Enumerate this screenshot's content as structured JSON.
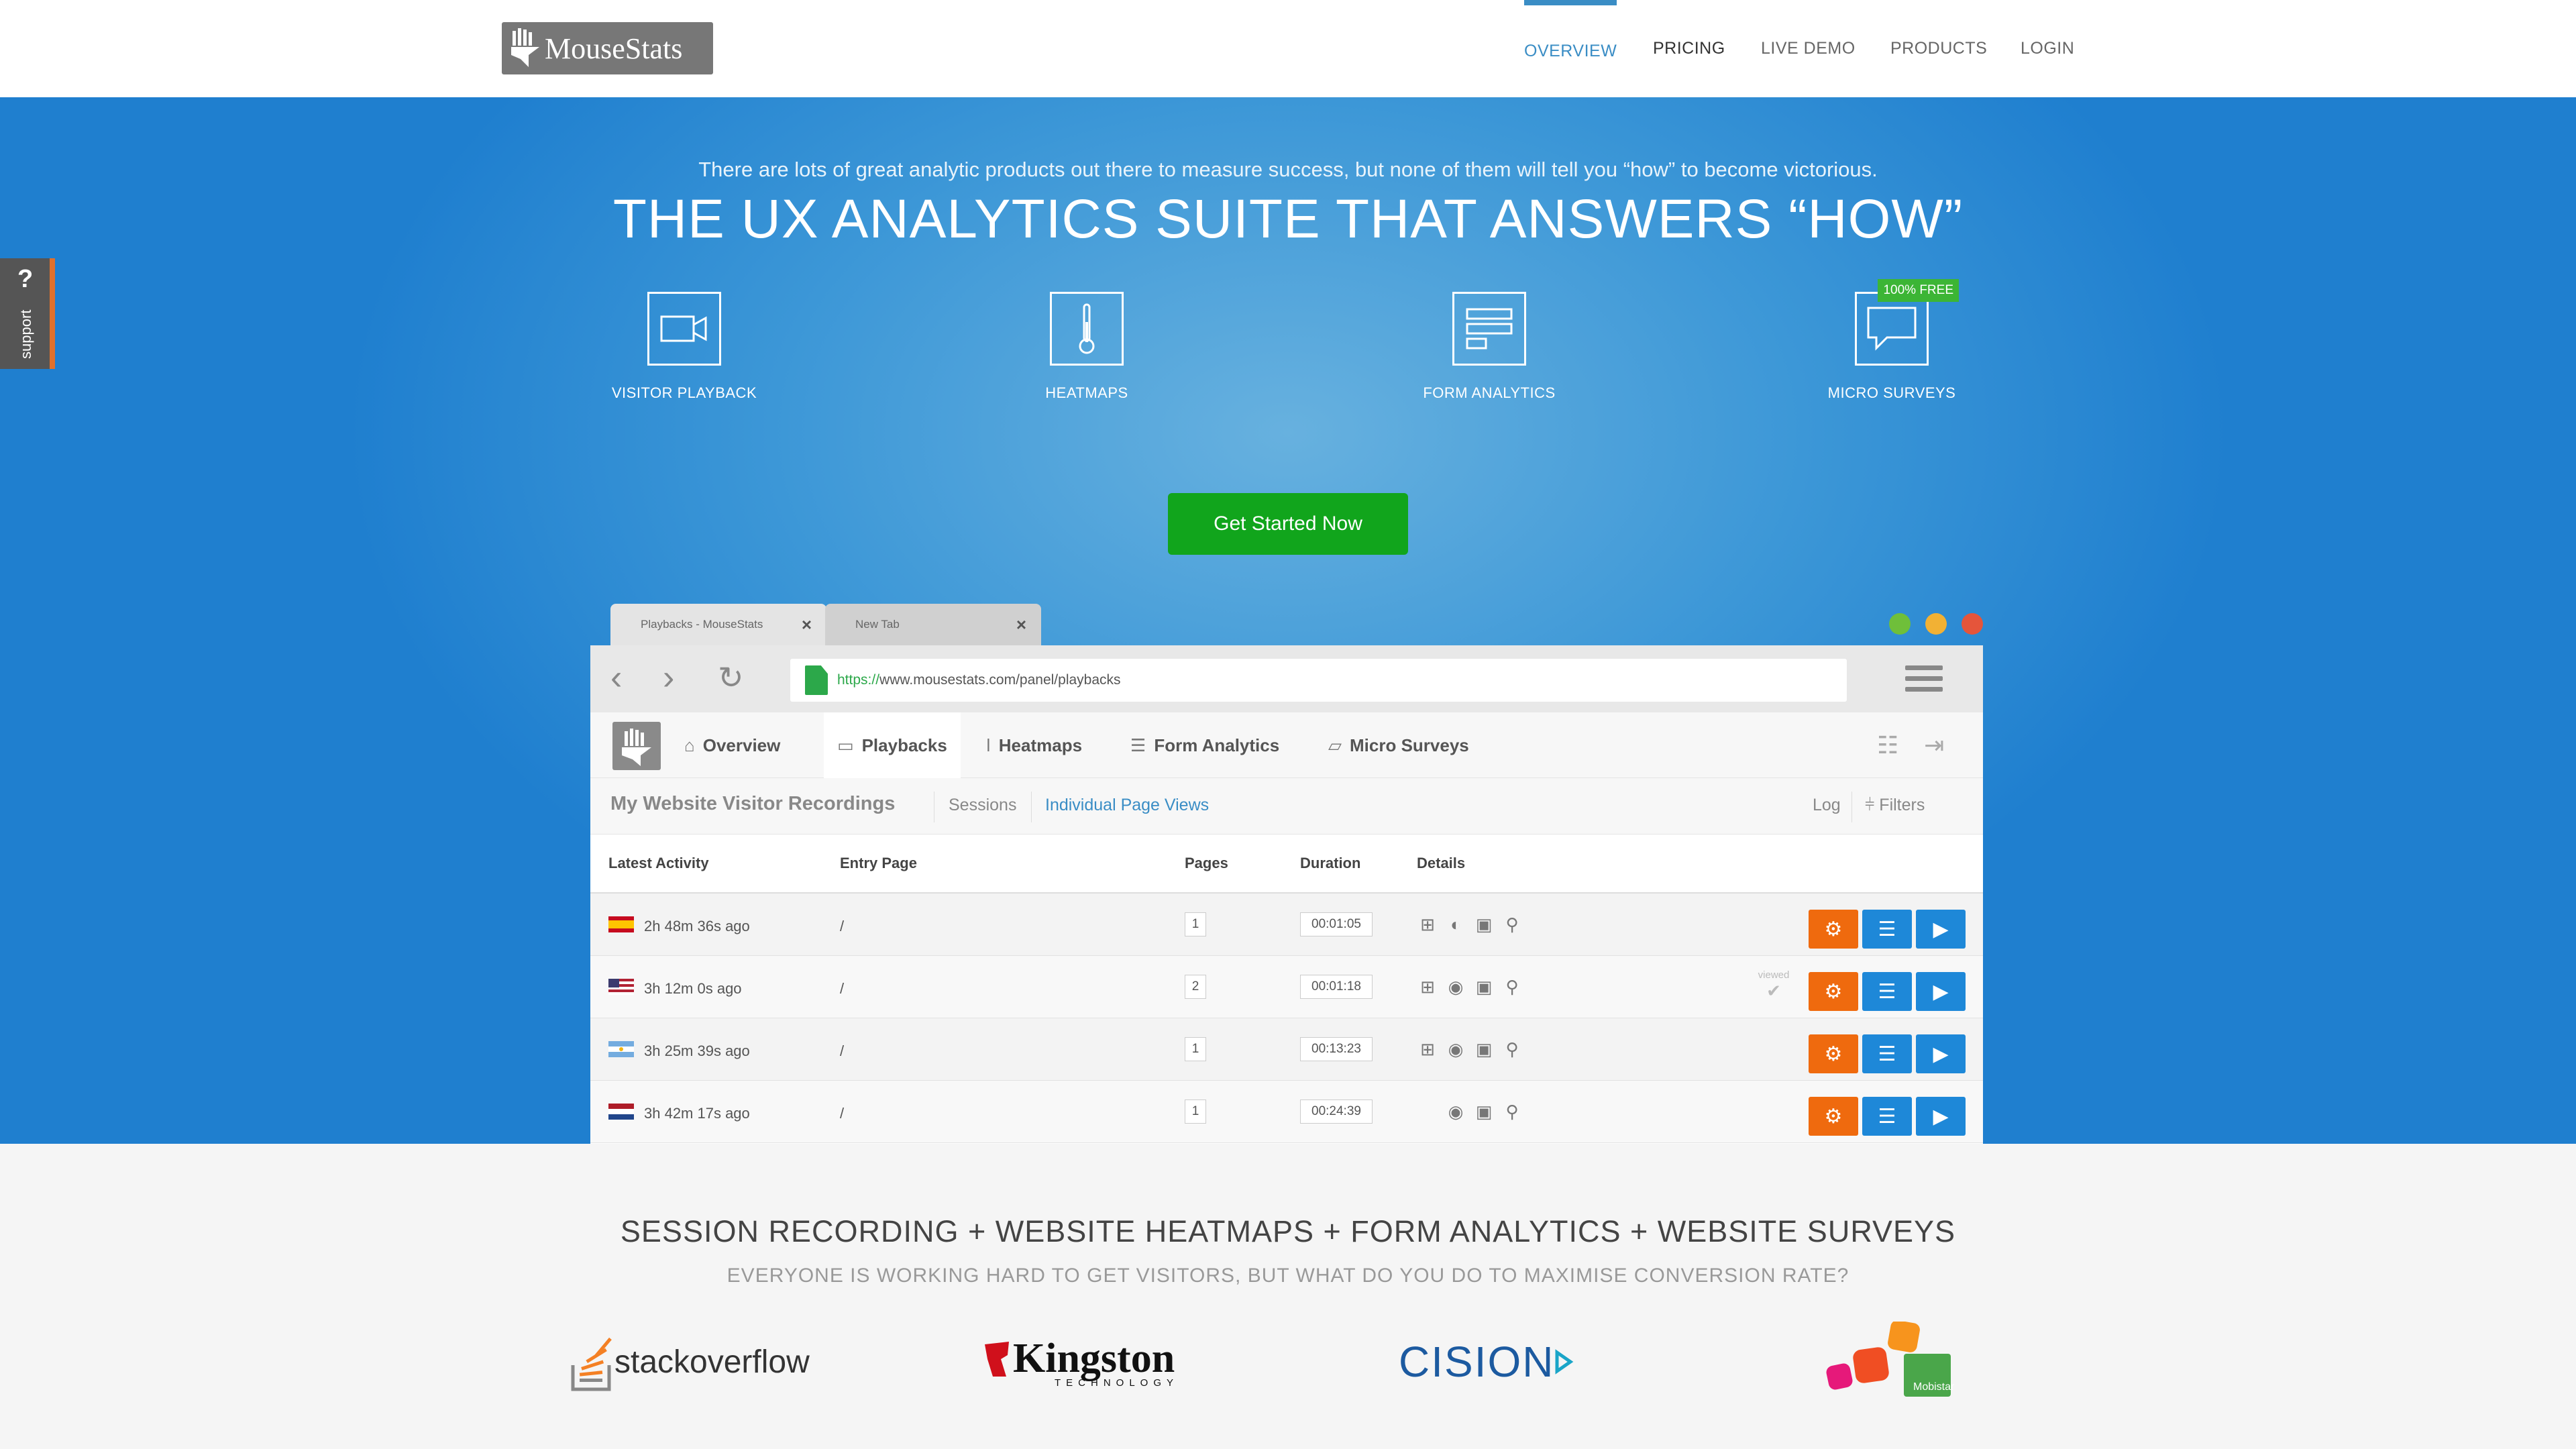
{
  "nav": {
    "logo_text": "MouseStats",
    "items": [
      "OVERVIEW",
      "PRICING",
      "LIVE DEMO",
      "PRODUCTS",
      "LOGIN"
    ],
    "active_color": "#3a8dc5"
  },
  "support": {
    "label": "support",
    "glyph": "?"
  },
  "hero": {
    "tagline": "There are lots of great analytic products out there to measure success, but none of them will tell you “how” to become victorious.",
    "headline": "THE UX ANALYTICS SUITE THAT ANSWERS “HOW”",
    "features": [
      {
        "label": "VISITOR PLAYBACK",
        "icon": "video-camera-icon"
      },
      {
        "label": "HEATMAPS",
        "icon": "thermometer-icon"
      },
      {
        "label": "FORM ANALYTICS",
        "icon": "form-icon"
      },
      {
        "label": "MICRO SURVEYS",
        "icon": "speech-bubble-icon",
        "badge": "100% FREE"
      }
    ],
    "cta": "Get Started Now",
    "cta_color": "#11a51c"
  },
  "browser": {
    "tabs": [
      {
        "label": "Playbacks - MouseStats"
      },
      {
        "label": "New Tab"
      }
    ],
    "url_scheme": "https://",
    "url_rest": "www.mousestats.com/panel/playbacks",
    "app_tabs": [
      "Overview",
      "Playbacks",
      "Heatmaps",
      "Form Analytics",
      "Micro Surveys"
    ],
    "subbar": {
      "title": "My Website Visitor Recordings",
      "links": [
        "Sessions",
        "Individual Page Views"
      ],
      "right": [
        "Log",
        "Filters"
      ]
    },
    "columns": [
      "Latest Activity",
      "Entry Page",
      "Pages",
      "Duration",
      "Details"
    ],
    "rows": [
      {
        "flag": "es",
        "ago": "2h 48m 36s ago",
        "entry": "/",
        "pages": "1",
        "duration": "00:01:05",
        "os": "windows-icon",
        "browser": "firefox-icon",
        "viewed": false
      },
      {
        "flag": "us",
        "ago": "3h 12m 0s ago",
        "entry": "/",
        "pages": "2",
        "duration": "00:01:18",
        "os": "windows-icon",
        "browser": "chrome-icon",
        "viewed": true
      },
      {
        "flag": "ar",
        "ago": "3h 25m 39s ago",
        "entry": "/",
        "pages": "1",
        "duration": "00:13:23",
        "os": "windows-icon",
        "browser": "chrome-icon",
        "viewed": false
      },
      {
        "flag": "nl",
        "ago": "3h 42m 17s ago",
        "entry": "/",
        "pages": "1",
        "duration": "00:24:39",
        "os": "apple-icon",
        "browser": "chrome-icon",
        "viewed": false
      }
    ],
    "viewed_label": "viewed"
  },
  "lower": {
    "title": "SESSION RECORDING + WEBSITE HEATMAPS + FORM ANALYTICS + WEBSITE SURVEYS",
    "subtitle": "EVERYONE IS WORKING HARD TO GET VISITORS, BUT WHAT DO YOU DO TO MAXIMISE CONVERSION RATE?",
    "brands": [
      "stackoverflow",
      "Kingston",
      "TECHNOLOGY",
      "CISION",
      "Mobistar"
    ]
  }
}
